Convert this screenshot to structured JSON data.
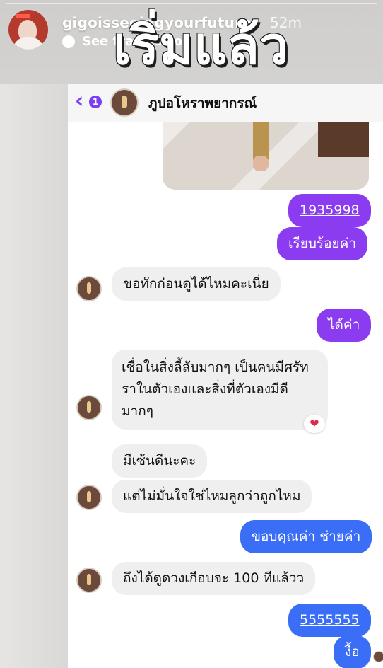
{
  "story": {
    "username": "gigoisseeingyourfuture",
    "time": "52m",
    "translate_label": "See translation",
    "overlay_text": "เริ่มแล้ว",
    "accent": "#ffffff"
  },
  "chat": {
    "unread_count": "1",
    "contact_name": "ภูปอโหราพยากรณ์",
    "accent_purple": "#8b3cf0",
    "accent_blue": "#3b6ef6",
    "messages": [
      {
        "dir": "out",
        "text": "1935998",
        "link": true
      },
      {
        "dir": "out",
        "text": "เรียบร้อยค่า"
      },
      {
        "dir": "in",
        "text": "ขอทักก่อนดูได้ไหมคะเนี่ย"
      },
      {
        "dir": "out",
        "text": "ได้ค่า"
      },
      {
        "dir": "in",
        "lines": [
          "เชื่อในสิ่งลี้ลับมากๆ เป็นคนมีศรัท",
          "ราในตัวเองและสิ่งที่ตัวเองมีดี",
          "มากๆ"
        ],
        "reaction": "❤"
      },
      {
        "dir": "in",
        "text": "มีเซ้นดีนะคะ"
      },
      {
        "dir": "in",
        "text": "แต่ไม่มั่นใจใช่ไหมลูกว่าถูกไหม"
      },
      {
        "dir": "out",
        "text": "ขอบคุณค่า ช่ายค่า"
      },
      {
        "dir": "in",
        "text": "ถึงได้ดูดวงเกือบจะ 100 ทีแล้วว"
      },
      {
        "dir": "out",
        "text": "5555555",
        "link": true
      },
      {
        "dir": "out",
        "text": "งื้อ"
      }
    ]
  }
}
